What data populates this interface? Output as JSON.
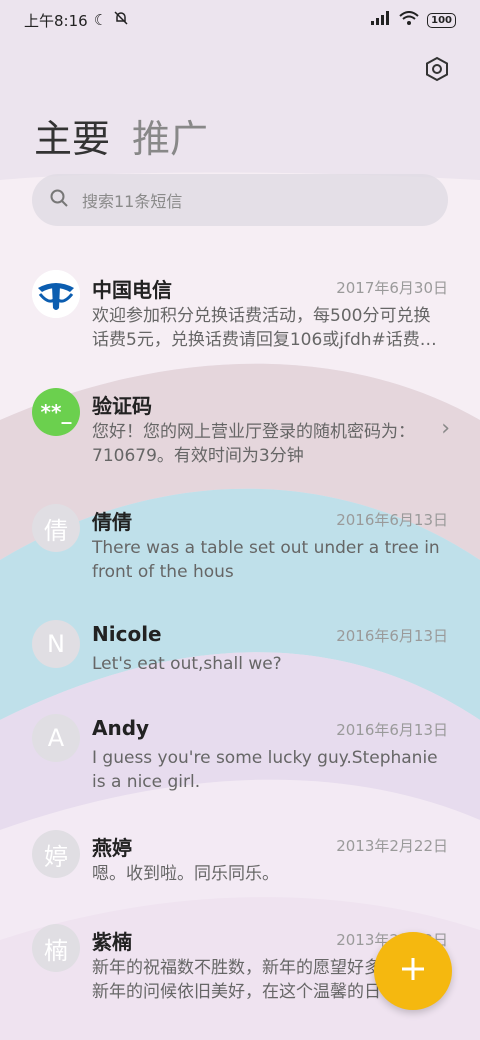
{
  "status": {
    "time": "上午8:16",
    "battery": "100"
  },
  "tabs": {
    "main": "主要",
    "promo": "推广"
  },
  "search": {
    "placeholder": "搜索11条短信"
  },
  "messages": [
    {
      "name": "中国电信",
      "date": "2017年6月30日",
      "preview": "欢迎参加积分兑换话费活动，每500分可兑换话费5元，兑换话费请回复106或jfdh#话费…",
      "avatar": ""
    },
    {
      "name": "验证码",
      "date": "",
      "preview": "您好！您的网上营业厅登录的随机密码为：710679。有效时间为3分钟",
      "avatar": "**_"
    },
    {
      "name": "倩倩",
      "date": "2016年6月13日",
      "preview": "There was a table set out under a tree in front of the hous",
      "avatar": "倩"
    },
    {
      "name": "Nicole",
      "date": "2016年6月13日",
      "preview": "Let's eat out,shall we?",
      "avatar": "N"
    },
    {
      "name": "Andy",
      "date": "2016年6月13日",
      "preview": "I guess you're some lucky guy.Stephanie is a nice girl.",
      "avatar": "A"
    },
    {
      "name": "燕婷",
      "date": "2013年2月22日",
      "preview": "嗯。收到啦。同乐同乐。",
      "avatar": "婷"
    },
    {
      "name": "紫楠",
      "date": "2013年2月22日",
      "preview": "新年的祝福数不胜数，新年的愿望好多好多，新年的问候依旧美好，在这个温馨的日子里",
      "avatar": "楠"
    }
  ],
  "icons": {
    "settings": "settings-hexagon-icon",
    "search": "search-icon",
    "fab": "plus-icon",
    "chevron": "chevron-right-icon"
  },
  "colors": {
    "fab": "#f5b80f",
    "verify_avatar": "#6bd04e",
    "telecom_blue": "#0b5db0"
  }
}
